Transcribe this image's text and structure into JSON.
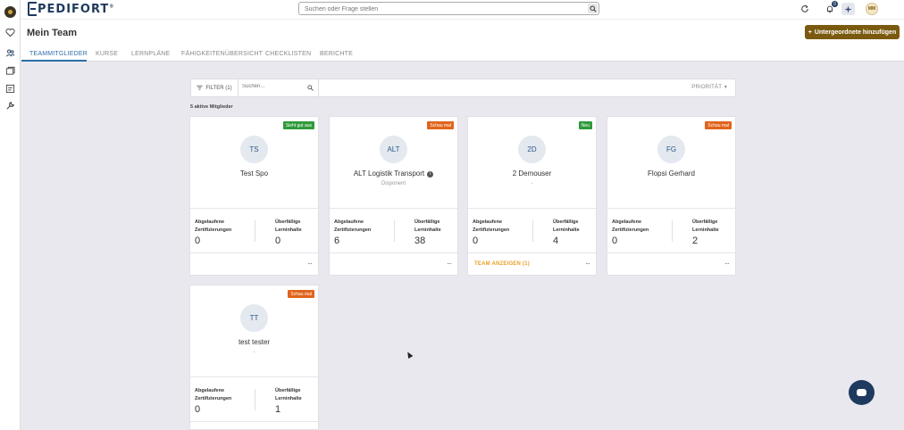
{
  "header": {
    "logo_text": "PEDIFORT",
    "logo_mark": "®",
    "search_placeholder": "Suchen oder Frage stellen",
    "notification_count": "0",
    "user_initials": "MM"
  },
  "page": {
    "title": "Mein Team",
    "add_button_label": "Untergeordnete hinzufügen"
  },
  "tabs": [
    {
      "label": "TEAMMITGLIEDER",
      "active": true
    },
    {
      "label": "KURSE",
      "active": false
    },
    {
      "label": "LERNPLÄNE",
      "active": false
    },
    {
      "label": "FÄHIGKEITENÜBERSICHT",
      "active": false
    },
    {
      "label": "CHECKLISTEN",
      "active": false
    },
    {
      "label": "BERICHTE",
      "active": false
    }
  ],
  "filter": {
    "filter_label": "FILTER (1)",
    "search_placeholder": "Suchen...",
    "sort_label": "PRIORITÄT"
  },
  "members_count": "5 aktive Mitglieder",
  "stat_labels": {
    "expired_line1": "Abgelaufene",
    "expired_line2": "Zertifizierungen",
    "overdue_line1": "Überfällige",
    "overdue_line2": "Lerninhalte"
  },
  "members": [
    {
      "initials": "TS",
      "name": "Test Spo",
      "role": "",
      "tag": "Sieht gut aus",
      "tag_color": "#2f9a3a",
      "expired": "0",
      "overdue": "0",
      "team_link": ""
    },
    {
      "initials": "ALT",
      "name": "ALT Logistik Transport",
      "role": "Disponent",
      "tag": "Schau mal",
      "tag_color": "#e0641c",
      "expired": "6",
      "overdue": "38",
      "team_link": ""
    },
    {
      "initials": "2D",
      "name": "2 Demouser",
      "role": "-",
      "tag": "Neu",
      "tag_color": "#2f9a3a",
      "expired": "0",
      "overdue": "4",
      "team_link": "TEAM ANZEIGEN (1)"
    },
    {
      "initials": "FG",
      "name": "Flopsi Gerhard",
      "role": "",
      "tag": "Schau mal",
      "tag_color": "#e0641c",
      "expired": "0",
      "overdue": "2",
      "team_link": ""
    },
    {
      "initials": "TT",
      "name": "test tester",
      "role": "-",
      "tag": "Schau mal",
      "tag_color": "#e0641c",
      "expired": "0",
      "overdue": "1",
      "team_link": ""
    }
  ],
  "more_label": "···"
}
